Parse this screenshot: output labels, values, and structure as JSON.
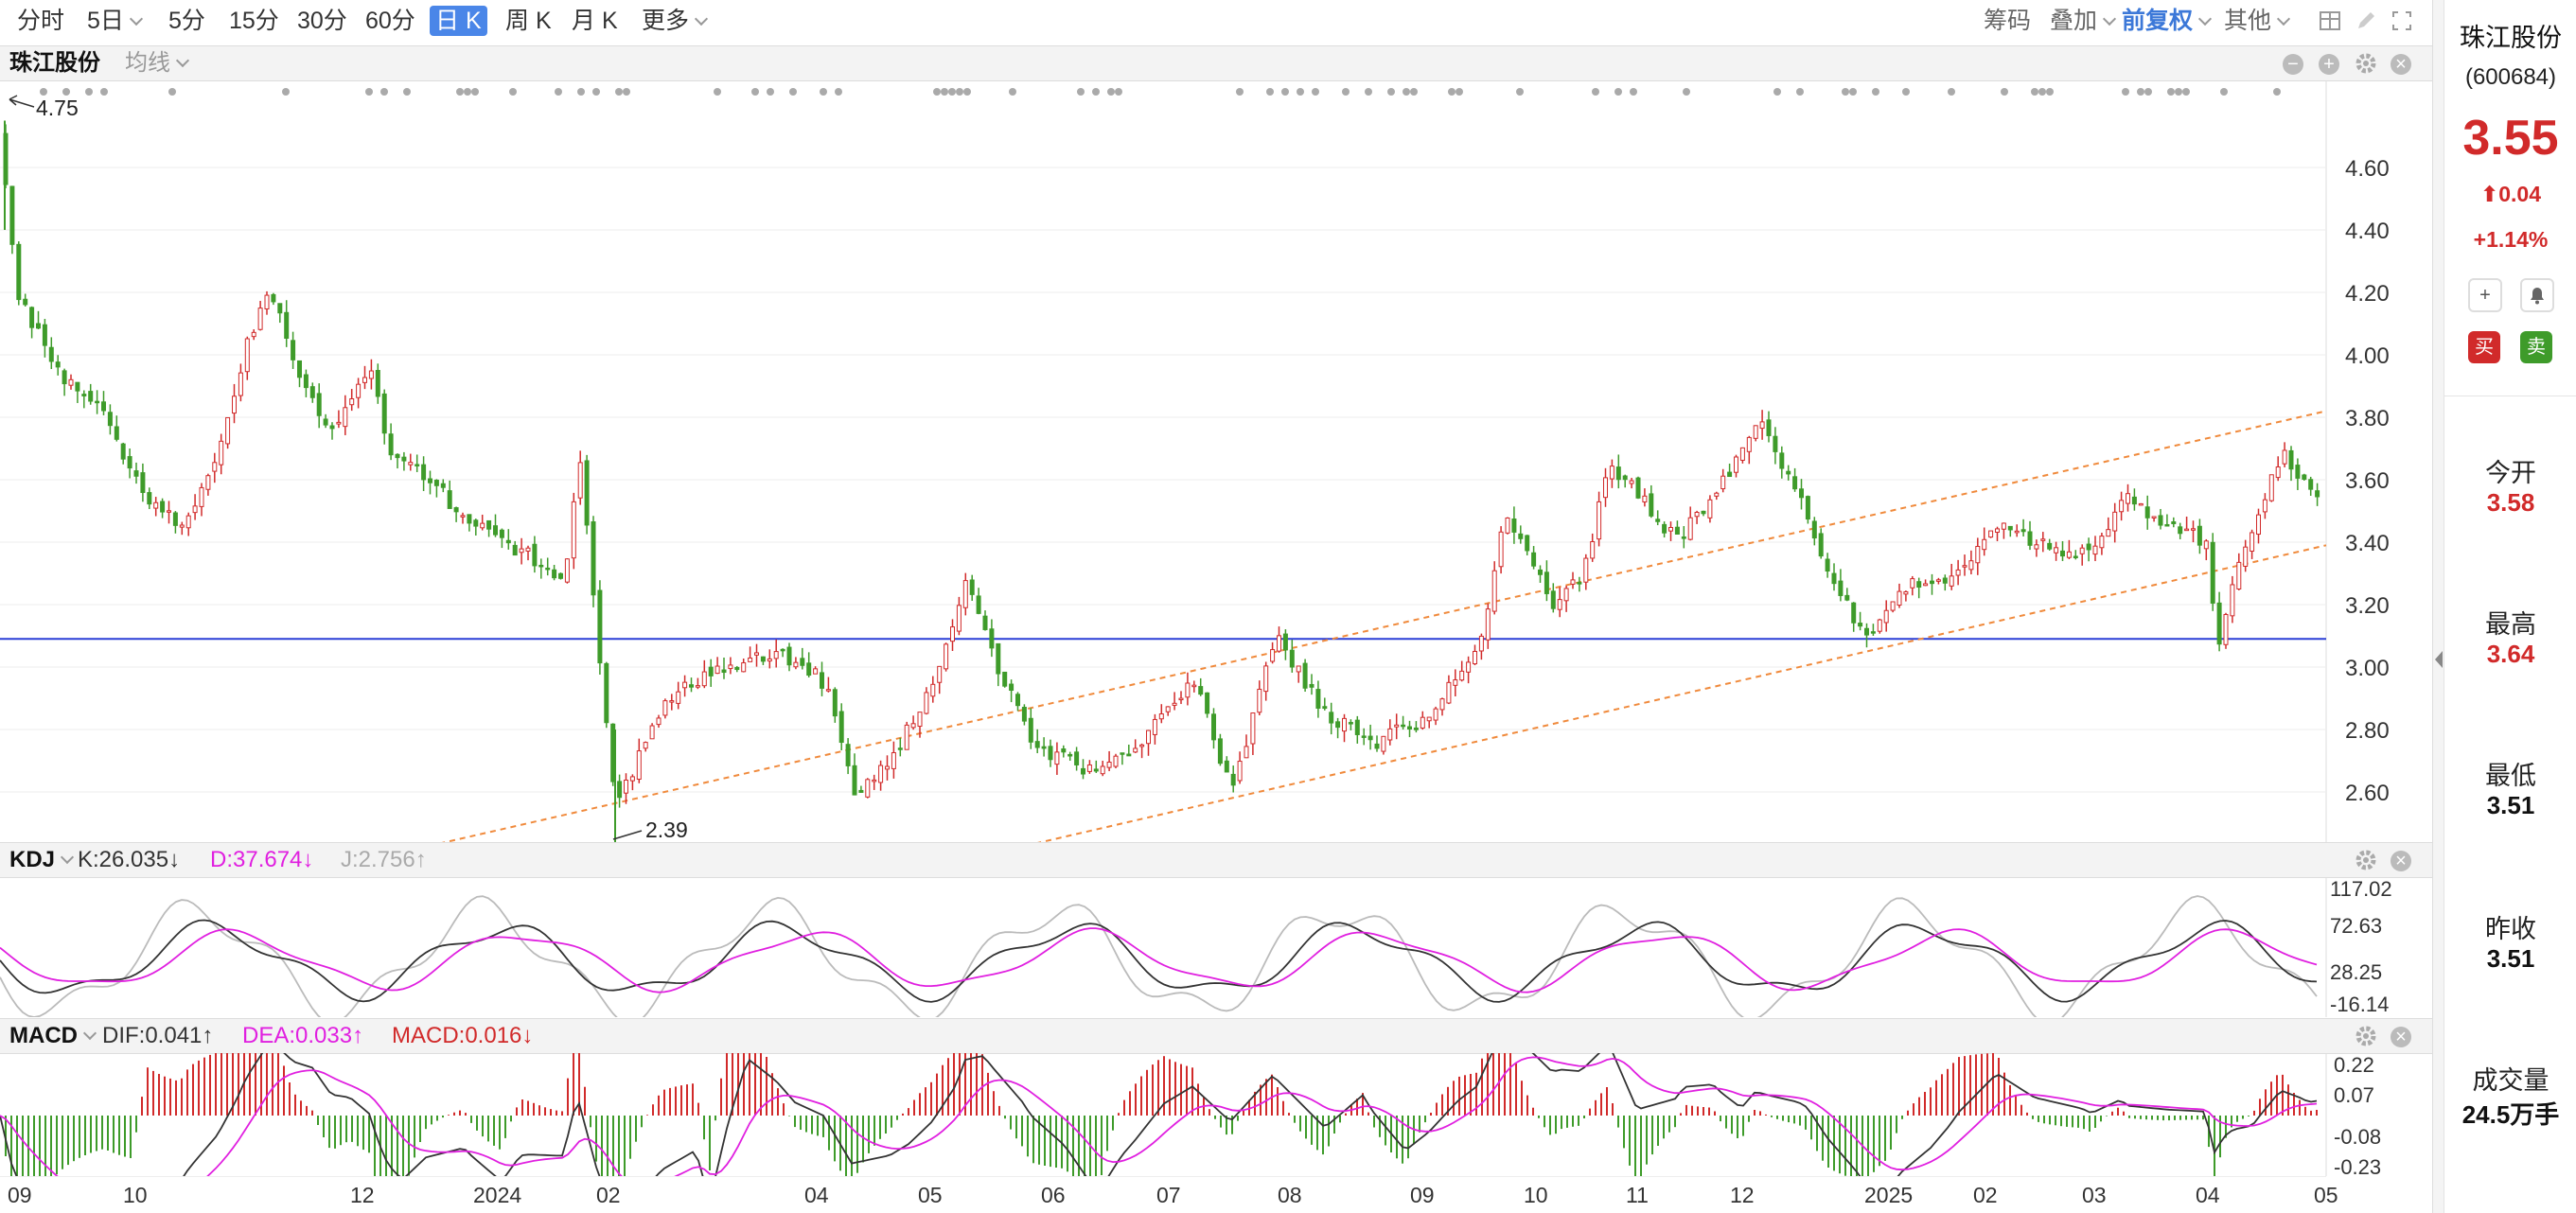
{
  "toolbar": {
    "periods": [
      "分时",
      "5日",
      "5分",
      "15分",
      "30分",
      "60分",
      "日 K",
      "周 K",
      "月 K",
      "更多"
    ],
    "active_period": "日 K",
    "right_items": [
      "筹码",
      "叠加",
      "前复权",
      "其他"
    ]
  },
  "main_panel": {
    "stock_name": "珠江股份",
    "ma_label": "均线",
    "high_marker": "4.75",
    "low_marker": "2.39",
    "price_axis": [
      "4.60",
      "4.40",
      "4.20",
      "4.00",
      "3.80",
      "3.60",
      "3.40",
      "3.20",
      "3.00",
      "2.80",
      "2.60"
    ]
  },
  "kdj_panel": {
    "name": "KDJ",
    "k": "K:26.035↓",
    "d": "D:37.674↓",
    "j": "J:2.756↑",
    "axis": [
      "117.02",
      "72.63",
      "28.25",
      "-16.14"
    ]
  },
  "macd_panel": {
    "name": "MACD",
    "dif": "DIF:0.041↑",
    "dea": "DEA:0.033↑",
    "macd": "MACD:0.016↓",
    "axis": [
      "0.22",
      "0.07",
      "-0.08",
      "-0.23"
    ]
  },
  "x_axis": [
    "09",
    "10",
    "12",
    "2024",
    "02",
    "04",
    "05",
    "06",
    "07",
    "08",
    "09",
    "10",
    "11",
    "12",
    "2025",
    "02",
    "03",
    "04",
    "05"
  ],
  "sidebar": {
    "name": "珠江股份",
    "code": "(600684)",
    "price": "3.55",
    "change": "0.04",
    "change_pct": "+1.14%",
    "buy": "买",
    "sell": "卖",
    "stats": [
      {
        "label": "今开",
        "value": "3.58"
      },
      {
        "label": "最高",
        "value": "3.64"
      },
      {
        "label": "最低",
        "value": "3.51"
      },
      {
        "label": "昨收",
        "value": "3.51"
      },
      {
        "label": "成交量",
        "value": "24.5万手"
      }
    ]
  },
  "colors": {
    "up": "#d12a2a",
    "down": "#3e9b2a",
    "accent": "#4a86e8",
    "support_line": "#2b3fd6",
    "channel": "#f08a3c",
    "d_line": "#e020e0"
  },
  "chart_data": {
    "type": "candlestick",
    "title": "珠江股份 (600684) 日K",
    "price_range": [
      2.39,
      4.75
    ],
    "horizontal_line": 3.09,
    "channel_lines": [
      {
        "from": [
          "2023-10-15",
          2.39
        ],
        "to": [
          "2025-04-30",
          3.82
        ]
      },
      {
        "from": [
          "2024-02-15",
          2.39
        ],
        "to": [
          "2025-04-30",
          3.39
        ]
      }
    ],
    "monthly_close_approx": [
      {
        "month": "2023-09",
        "close": 4.1
      },
      {
        "month": "2023-10",
        "close": 3.55
      },
      {
        "month": "2023-11",
        "close": 4.05
      },
      {
        "month": "2023-12",
        "close": 3.7
      },
      {
        "month": "2024-01",
        "close": 3.3
      },
      {
        "month": "2024-02",
        "close": 2.9
      },
      {
        "month": "2024-03",
        "close": 3.05
      },
      {
        "month": "2024-04",
        "close": 2.65
      },
      {
        "month": "2024-05",
        "close": 3.3
      },
      {
        "month": "2024-06",
        "close": 2.65
      },
      {
        "month": "2024-07",
        "close": 2.7
      },
      {
        "month": "2024-08",
        "close": 2.85
      },
      {
        "month": "2024-09",
        "close": 3.05
      },
      {
        "month": "2024-10",
        "close": 3.25
      },
      {
        "month": "2024-11",
        "close": 3.6
      },
      {
        "month": "2024-12",
        "close": 3.85
      },
      {
        "month": "2025-01",
        "close": 3.15
      },
      {
        "month": "2025-02",
        "close": 3.45
      },
      {
        "month": "2025-03",
        "close": 3.45
      },
      {
        "month": "2025-04",
        "close": 3.3
      },
      {
        "month": "2025-05",
        "close": 3.55
      }
    ]
  }
}
